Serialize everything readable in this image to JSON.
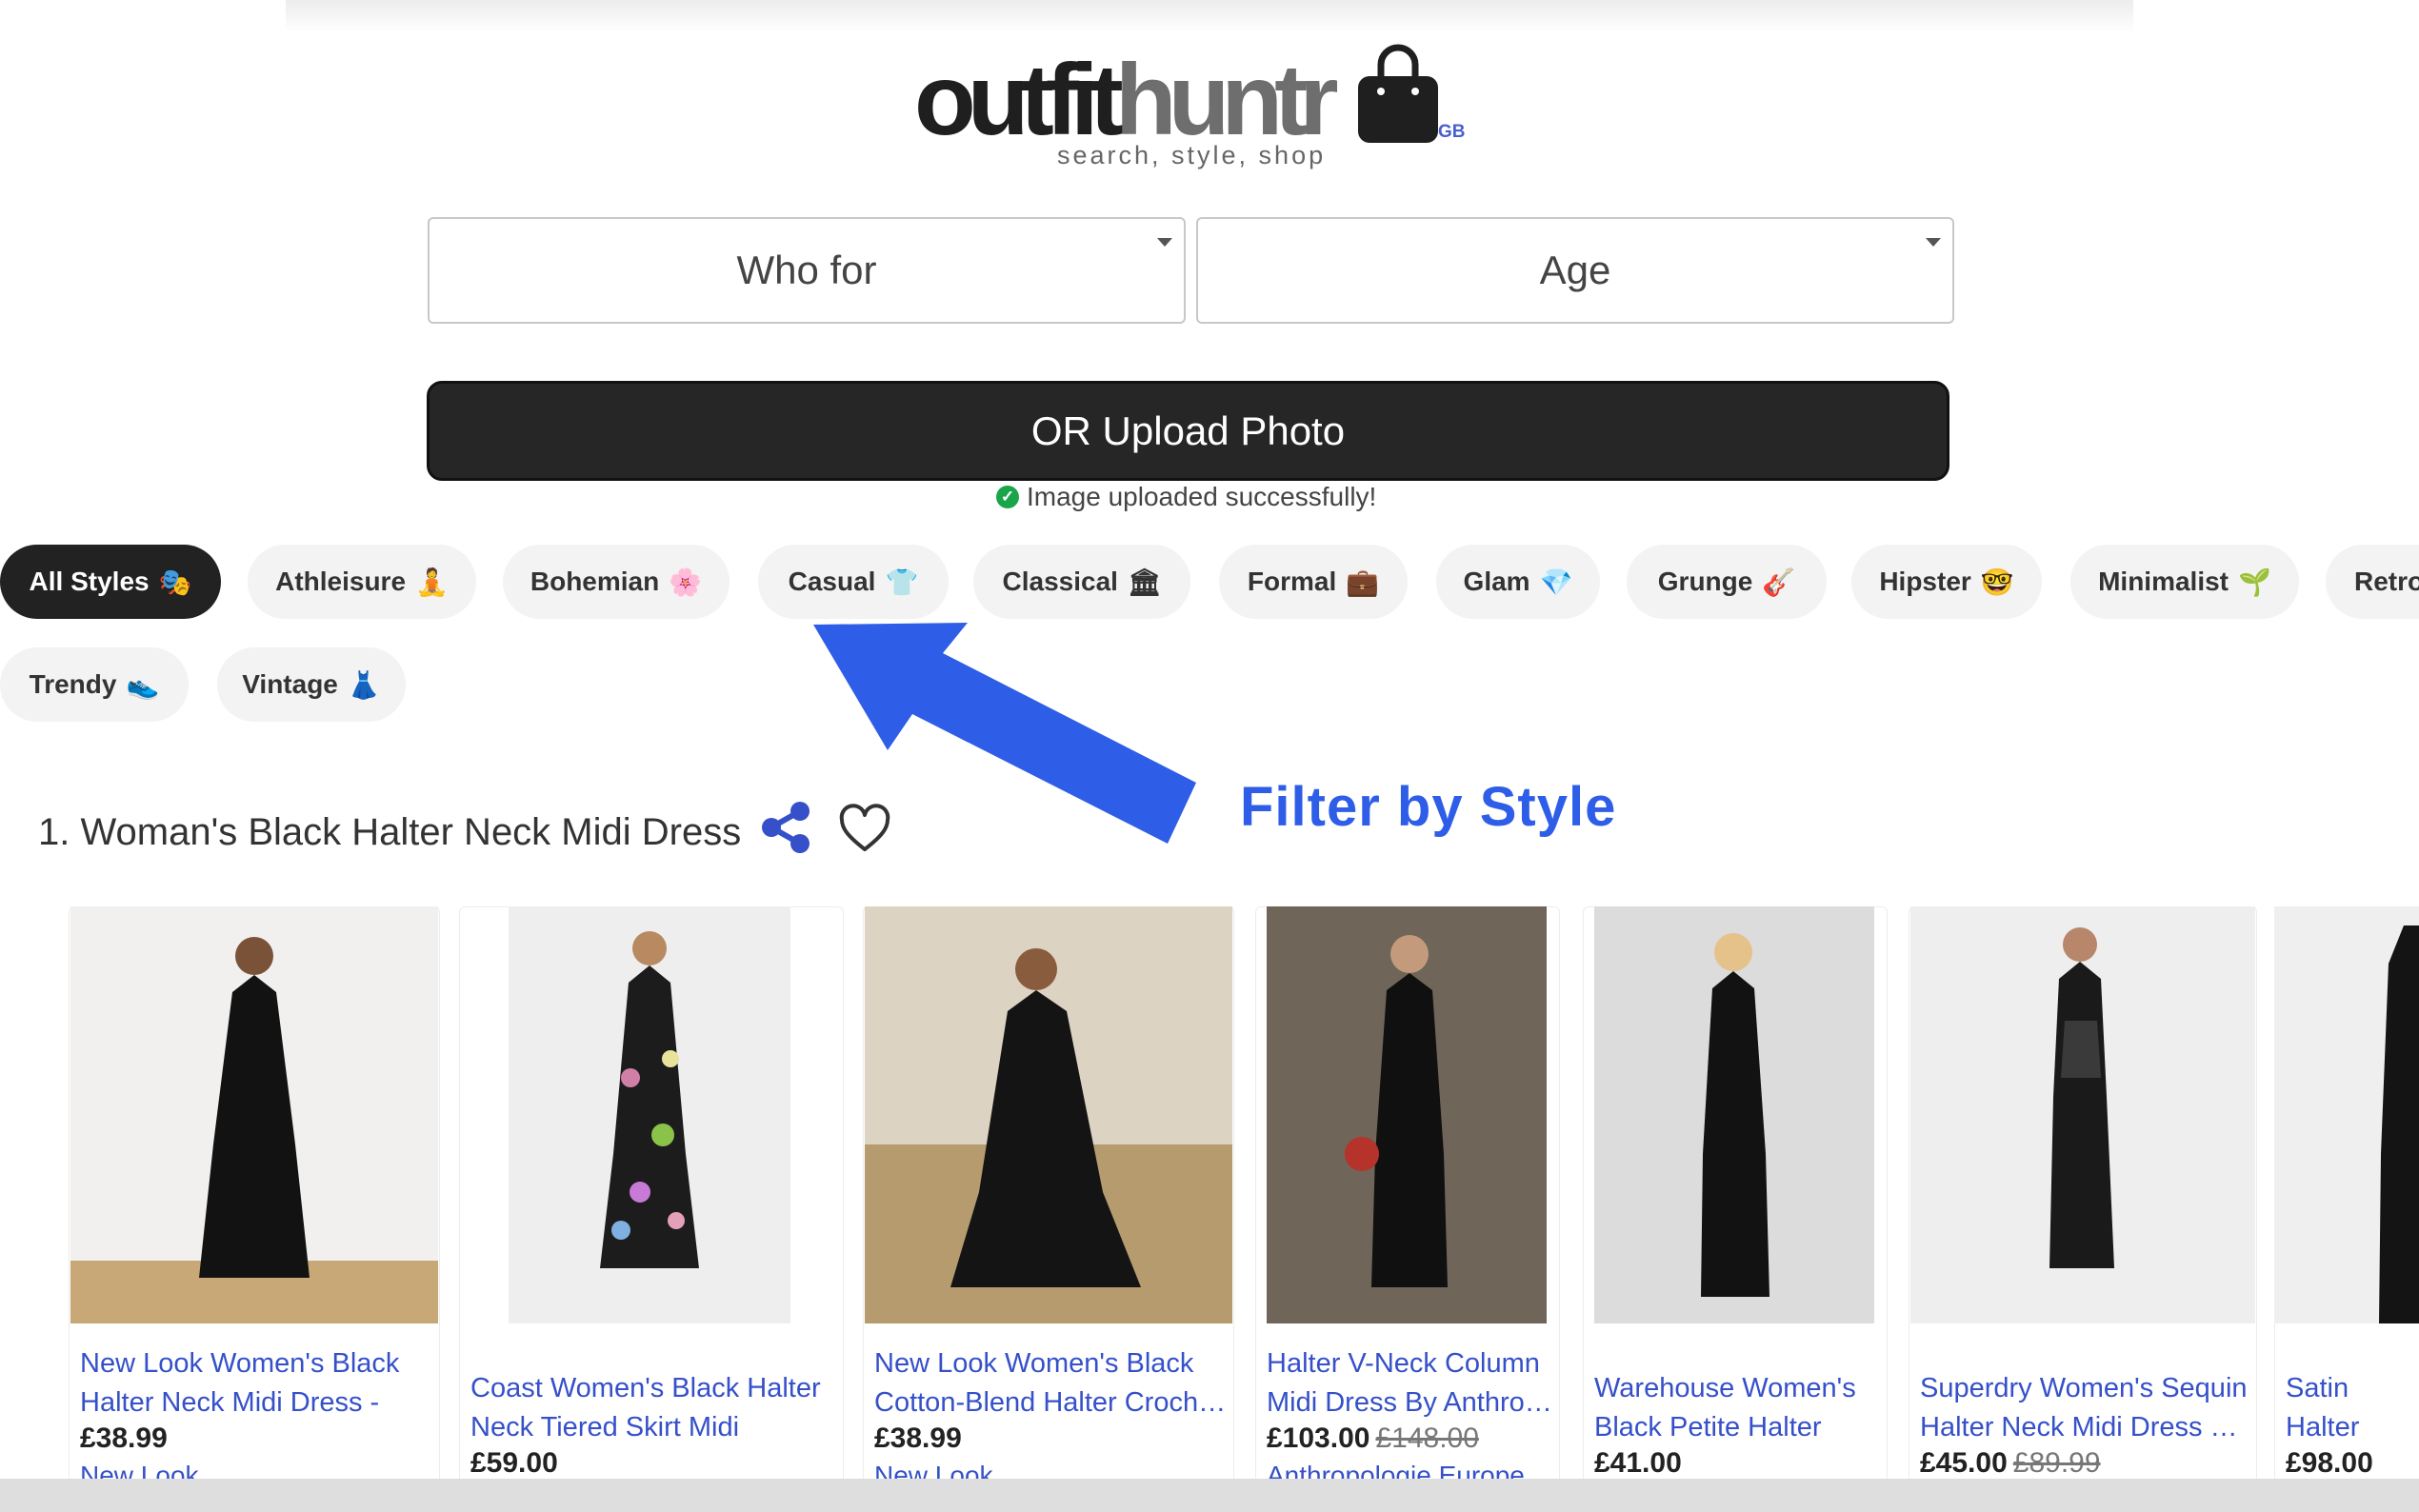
{
  "logo": {
    "part1": "outfit",
    "part2": "huntr",
    "tagline": "search, style, shop",
    "region": "GB"
  },
  "filters": {
    "who_for": "Who for",
    "age": "Age"
  },
  "upload": {
    "button_label": "OR Upload Photo",
    "status": "Image uploaded successfully!"
  },
  "styles": [
    {
      "label": "All Styles",
      "emoji": "🎭"
    },
    {
      "label": "Athleisure",
      "emoji": "🧘"
    },
    {
      "label": "Bohemian",
      "emoji": "🌸"
    },
    {
      "label": "Casual",
      "emoji": "👕"
    },
    {
      "label": "Classical",
      "emoji": "🏛"
    },
    {
      "label": "Formal",
      "emoji": "💼"
    },
    {
      "label": "Glam",
      "emoji": "💎"
    },
    {
      "label": "Grunge",
      "emoji": "🎸"
    },
    {
      "label": "Hipster",
      "emoji": "🤓"
    },
    {
      "label": "Minimalist",
      "emoji": "🌱"
    },
    {
      "label": "Retro",
      "emoji": ""
    },
    {
      "label": "Trendy",
      "emoji": "👟"
    },
    {
      "label": "Vintage",
      "emoji": "👗"
    }
  ],
  "annotation": "Filter by Style",
  "outfit": {
    "title": "1. Woman's Black Halter Neck Midi Dress"
  },
  "products": [
    {
      "title": "New Look Women's Black Halter Neck Midi Dress - U…",
      "price": "£38.99",
      "old_price": "",
      "merchant": "New Look"
    },
    {
      "title": "Coast Women's Black Halter Neck Tiered Skirt Midi Dres…",
      "price": "£59.00",
      "old_price": "",
      "merchant": ""
    },
    {
      "title": "New Look Women's Black Cotton-Blend Halter Croch…",
      "price": "£38.99",
      "old_price": "",
      "merchant": "New Look"
    },
    {
      "title": "Halter V-Neck Column Midi Dress By Anthro…",
      "price": "£103.00",
      "old_price": "£148.00",
      "merchant": "Anthropologie Europe"
    },
    {
      "title": "Warehouse Women's Black Petite Halter Mi…",
      "price": "£41.00",
      "old_price": "",
      "merchant": ""
    },
    {
      "title": "Superdry Women's Sequin Halter Neck Midi Dress …",
      "price": "£45.00",
      "old_price": "£89.99",
      "merchant": ""
    },
    {
      "title": "Satin Halter Dress, Blac",
      "price": "£98.00",
      "old_price": "",
      "merchant": ""
    }
  ],
  "colors": {
    "accent": "#3550c9",
    "dark": "#262626",
    "annotation": "#2e5ee8",
    "chip_bg": "#f3f3f3"
  }
}
